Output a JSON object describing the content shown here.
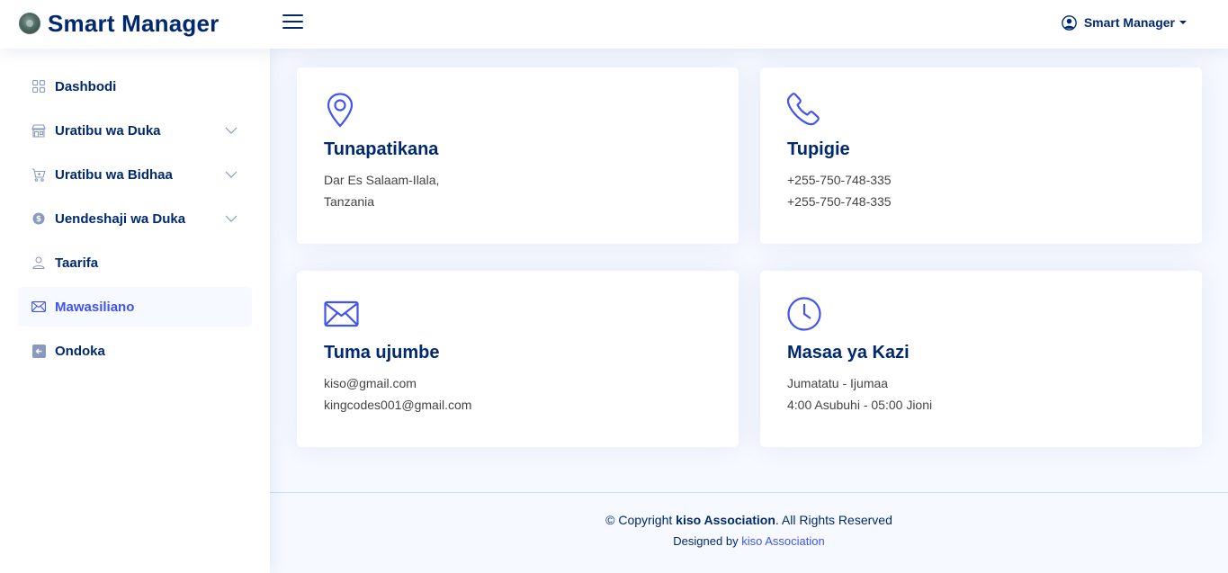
{
  "header": {
    "app_title": "Smart Manager",
    "user_name": "Smart Manager"
  },
  "sidebar": {
    "items": [
      {
        "label": "Dashbodi",
        "icon": "grid-icon",
        "expandable": false,
        "active": false
      },
      {
        "label": "Uratibu wa Duka",
        "icon": "shop-icon",
        "expandable": true,
        "active": false
      },
      {
        "label": "Uratibu wa Bidhaa",
        "icon": "cart-icon",
        "expandable": true,
        "active": false
      },
      {
        "label": "Uendeshaji wa Duka",
        "icon": "coin-icon",
        "expandable": true,
        "active": false
      },
      {
        "label": "Taarifa",
        "icon": "person-icon",
        "expandable": false,
        "active": false
      },
      {
        "label": "Mawasiliano",
        "icon": "envelope-icon",
        "expandable": false,
        "active": true
      },
      {
        "label": "Ondoka",
        "icon": "arrow-left-square-icon",
        "expandable": false,
        "active": false
      }
    ]
  },
  "contact": {
    "cards": [
      {
        "icon": "geo-alt-icon",
        "title": "Tunapatikana",
        "lines": [
          "Dar Es Salaam-Ilala,",
          "Tanzania"
        ]
      },
      {
        "icon": "telephone-icon",
        "title": "Tupigie",
        "lines": [
          "+255-750-748-335",
          "+255-750-748-335"
        ]
      },
      {
        "icon": "envelope-icon",
        "title": "Tuma ujumbe",
        "lines": [
          "kiso@gmail.com",
          "kingcodes001@gmail.com"
        ]
      },
      {
        "icon": "clock-icon",
        "title": "Masaa ya Kazi",
        "lines": [
          "Jumatatu - Ijumaa",
          "4:00 Asubuhi - 05:00 Jioni"
        ]
      }
    ]
  },
  "footer": {
    "copyright_prefix": "© Copyright ",
    "copyright_org": "kiso Association",
    "copyright_suffix": ". All Rights Reserved",
    "designed_by_prefix": "Designed by ",
    "designed_by_link": "kiso Association"
  },
  "colors": {
    "primary": "#012970",
    "accent": "#4154f1",
    "background": "#f6f9ff"
  }
}
